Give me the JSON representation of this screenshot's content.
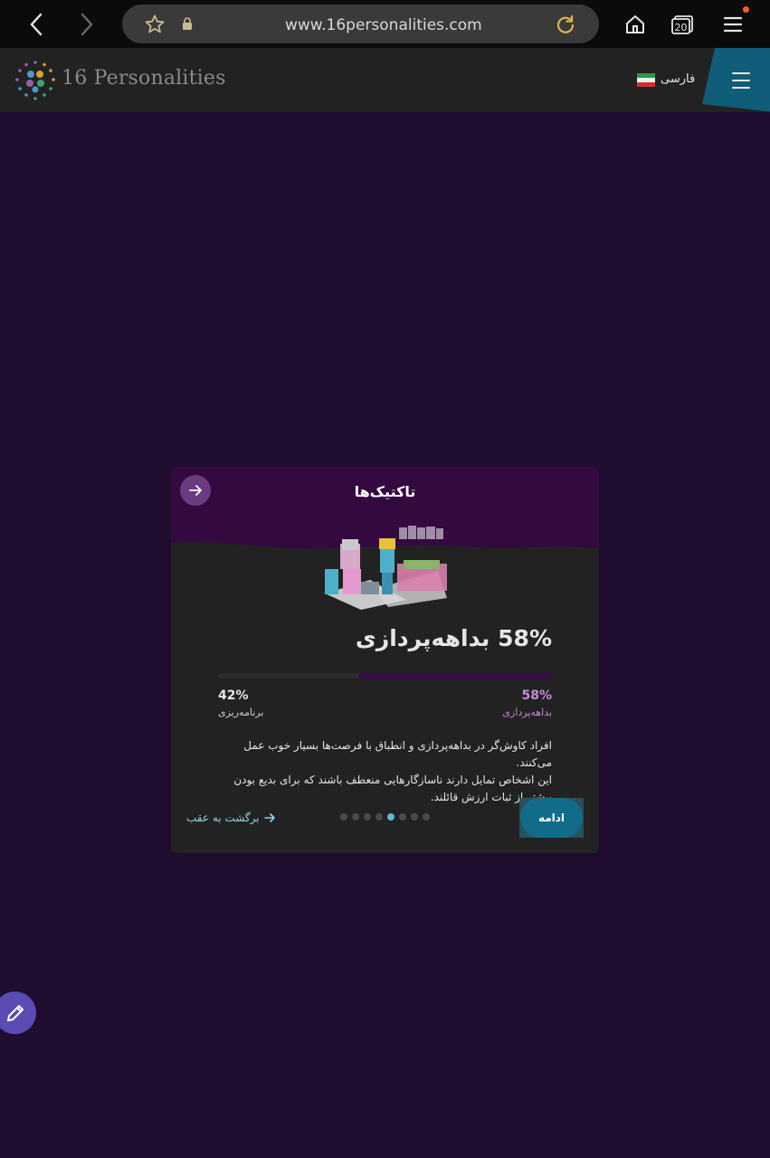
{
  "browser": {
    "url": "www.16personalities.com",
    "tab_count": "20"
  },
  "site": {
    "logo_text": "16 Personalities",
    "language_label": "فارسی"
  },
  "card": {
    "title": "تاکتیک‌ها",
    "headline": "58% بداهه‌پردازی",
    "progress": {
      "right_percent": 58,
      "left_percent": 42
    },
    "right_pct_label": "58%",
    "right_trait_label": "بداهه‌پردازی",
    "left_pct_label": "42%",
    "left_trait_label": "برنامه‌ریزی",
    "description_lines": [
      "افراد کاوش‌گر در بداهه‌پردازی و انطباق با فرصت‌ها بسیار خوب عمل می‌کنند.",
      "این اشخاص تمایل دارند ناسازگارهایی منعطف باشند که برای بدیع بودن",
      "بیشتر از ثبات ارزش قائلند."
    ],
    "back_label": "برگشت به عقب",
    "continue_label": "ادامه",
    "pagination": {
      "total": 8,
      "active_index": 4
    }
  },
  "colors": {
    "page_bg": "#200c2e",
    "card_bg": "#222222",
    "card_top": "#33093f",
    "accent_blue": "#116c8a",
    "trait_purple": "#c88ad6",
    "fab": "#5b4bb4"
  }
}
